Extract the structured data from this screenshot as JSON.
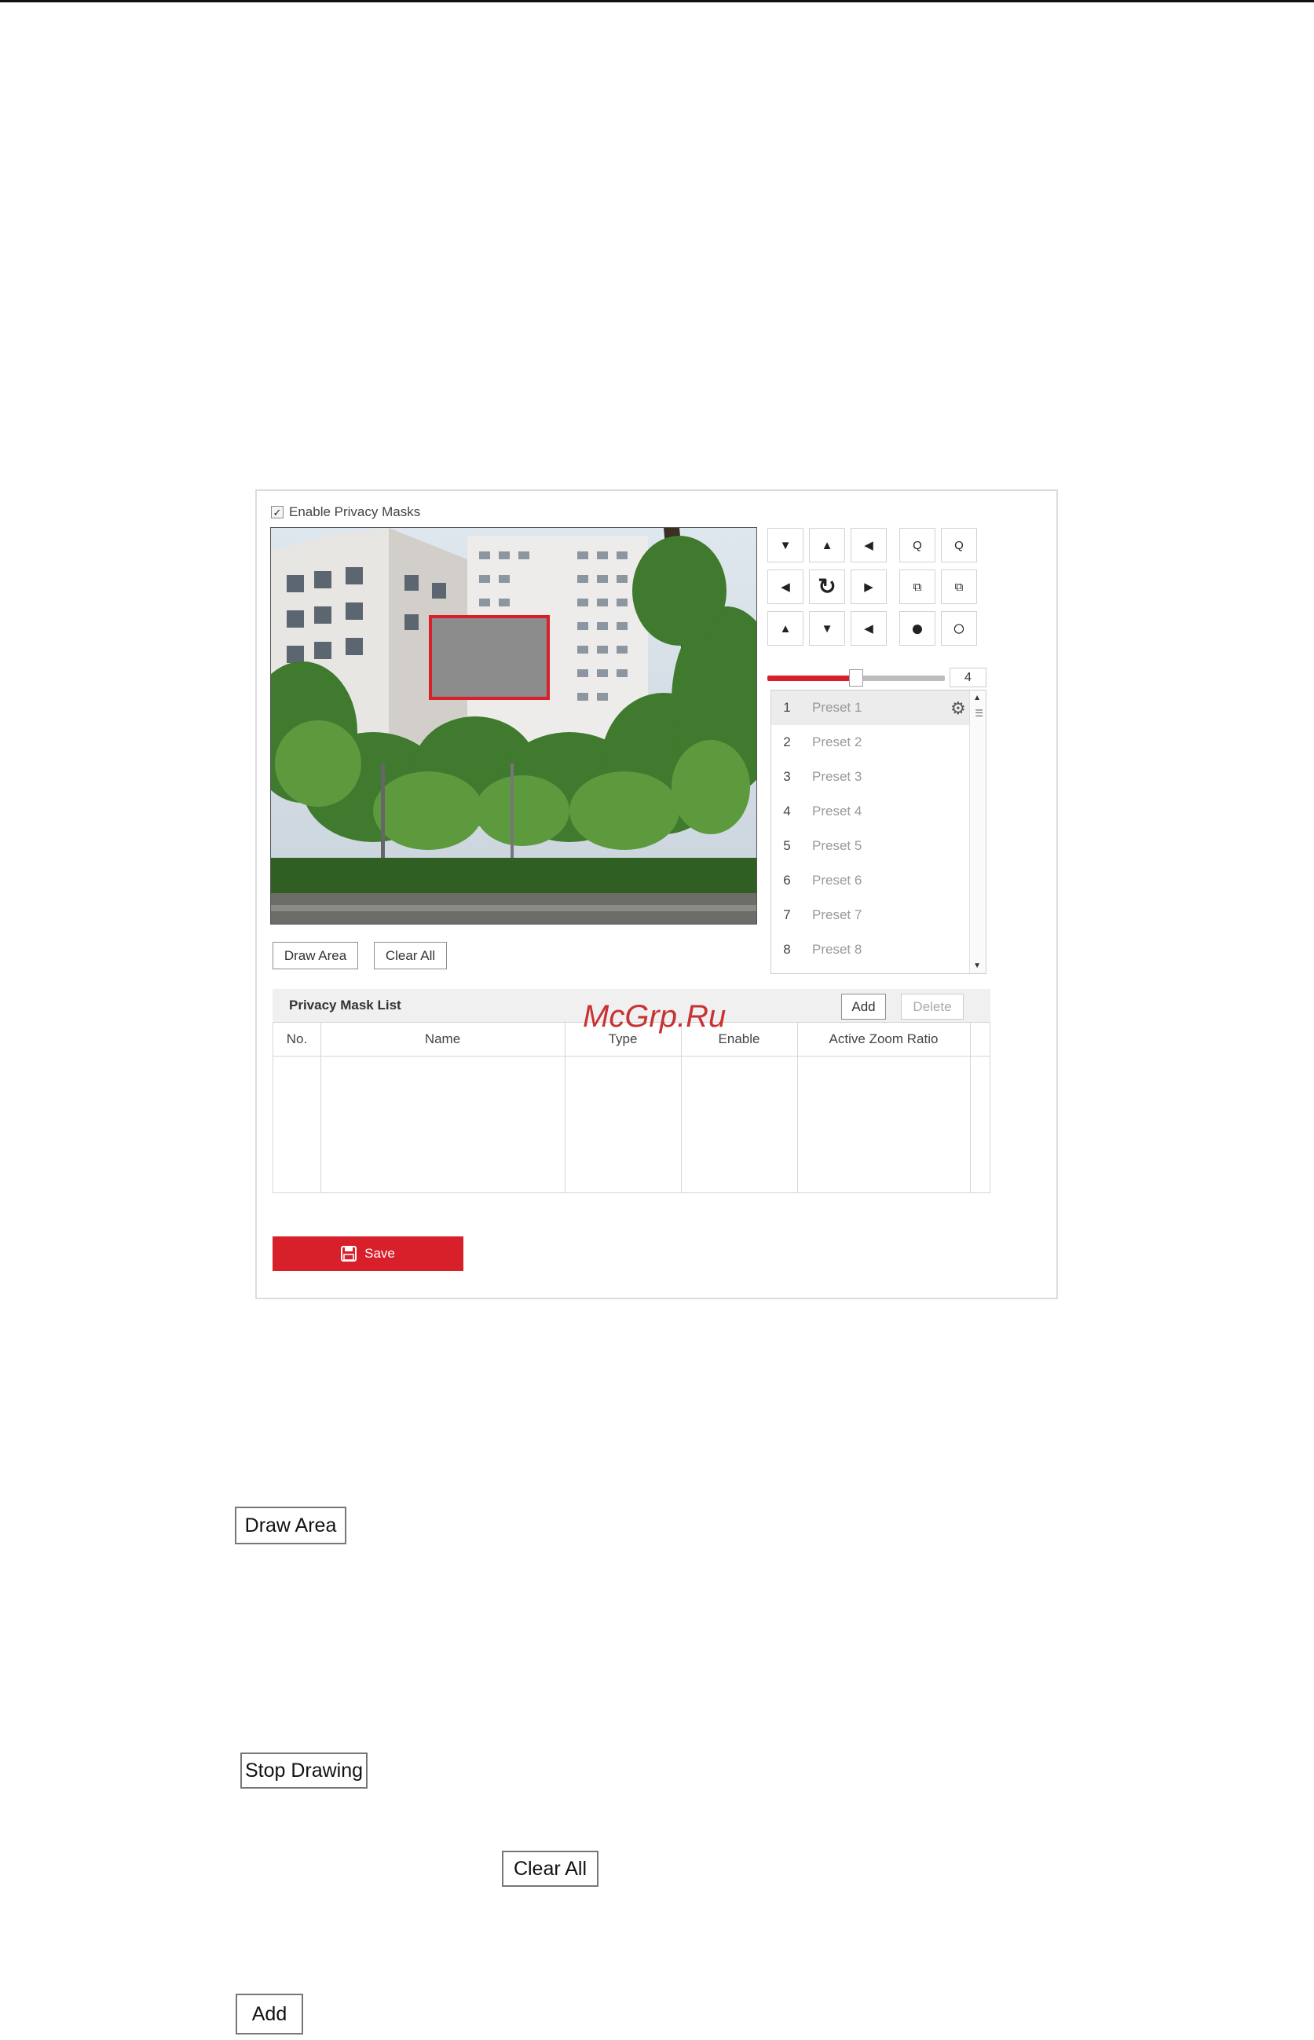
{
  "privacy": {
    "enable_label": "Enable Privacy Masks",
    "enable_checked": true
  },
  "ptz": {
    "speed_value": "4",
    "speed_fraction": 0.5,
    "icons": [
      "arrow-down-right-icon",
      "arrow-up-icon",
      "arrow-down-left-icon",
      "zoom-out-icon",
      "zoom-in-icon",
      "arrow-left-icon",
      "auto-pan-icon",
      "arrow-right-icon",
      "focus-near-icon",
      "focus-far-icon",
      "arrow-up-left-icon",
      "arrow-down-icon",
      "arrow-up-right-icon",
      "iris-close-icon",
      "iris-open-icon"
    ]
  },
  "presets": [
    {
      "num": "1",
      "name": "Preset 1"
    },
    {
      "num": "2",
      "name": "Preset 2"
    },
    {
      "num": "3",
      "name": "Preset 3"
    },
    {
      "num": "4",
      "name": "Preset 4"
    },
    {
      "num": "5",
      "name": "Preset 5"
    },
    {
      "num": "6",
      "name": "Preset 6"
    },
    {
      "num": "7",
      "name": "Preset 7"
    },
    {
      "num": "8",
      "name": "Preset 8"
    }
  ],
  "area_buttons": {
    "draw_area": "Draw Area",
    "clear_all": "Clear All"
  },
  "mask_list": {
    "title": "Privacy Mask List",
    "add": "Add",
    "delete": "Delete",
    "columns": [
      "No.",
      "Name",
      "Type",
      "Enable",
      "Active Zoom Ratio"
    ]
  },
  "save_label": "Save",
  "watermark": "McGrp.Ru",
  "doc_buttons": {
    "draw_area": "Draw Area",
    "stop_drawing": "Stop Drawing",
    "clear_all": "Clear All",
    "add": "Add"
  },
  "colors": {
    "accent": "#d7202a",
    "mask_fill": "#8c8c8c"
  }
}
